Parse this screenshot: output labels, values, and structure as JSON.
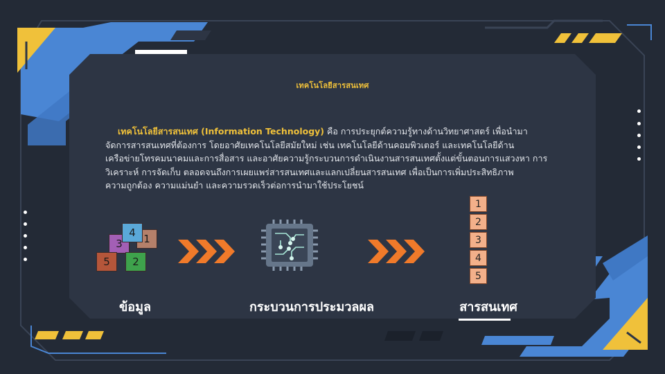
{
  "slide": {
    "title": "เทคโนโลยีสารสนเทศ",
    "paragraph": {
      "highlight": "เทคโนโลยีสารสนเทศ (Information Technology)",
      "lines": [
        " คือ การประยุกต์ความรู้ทางด้านวิทยาศาสตร์ เพื่อนำมา",
        "จัดการสารสนเทศที่ต้องการ โดยอาศัยเทคโนโลยีสมัยใหม่ เช่น เทคโนโลยีด้านคอมพิวเตอร์ และเทคโนโลยีด้าน",
        "เครือข่ายโทรคมนาคมและการสื่อสาร และอาศัยความรู้กระบวนการดำเนินงานสารสนเทศตั้งแต่ขั้นตอนการแสวงหา การ",
        "วิเคราะห์ การจัดเก็บ ตลอดจนถึงการเผยแพร่สารสนเทศและแลกเปลี่ยนสารสนเทศ เพื่อเป็นการเพิ่มประสิทธิภาพ",
        "ความถูกต้อง ความแม่นยำ และความรวดเร็วต่อการนำมาใช้ประโยชน์"
      ]
    },
    "diagram": {
      "data_label": "ข้อมูล",
      "process_label": "กระบวนการประมวลผล",
      "info_label": "สารสนเทศ",
      "cubes": [
        {
          "num": "4",
          "color": "#5aa8d8"
        },
        {
          "num": "3",
          "color": "#a35fb5"
        },
        {
          "num": "1",
          "color": "#b5806a"
        },
        {
          "num": "5",
          "color": "#b5563a"
        },
        {
          "num": "2",
          "color": "#3ea24c"
        }
      ],
      "stack": [
        "1",
        "2",
        "3",
        "4",
        "5"
      ]
    }
  },
  "colors": {
    "background": "#232a36",
    "accent_blue": "#4a86d4",
    "accent_yellow": "#f0c13a",
    "arrow_orange": "#f07a2a"
  },
  "icons": [
    "chevron-arrow-icon",
    "cpu-chip-icon"
  ]
}
